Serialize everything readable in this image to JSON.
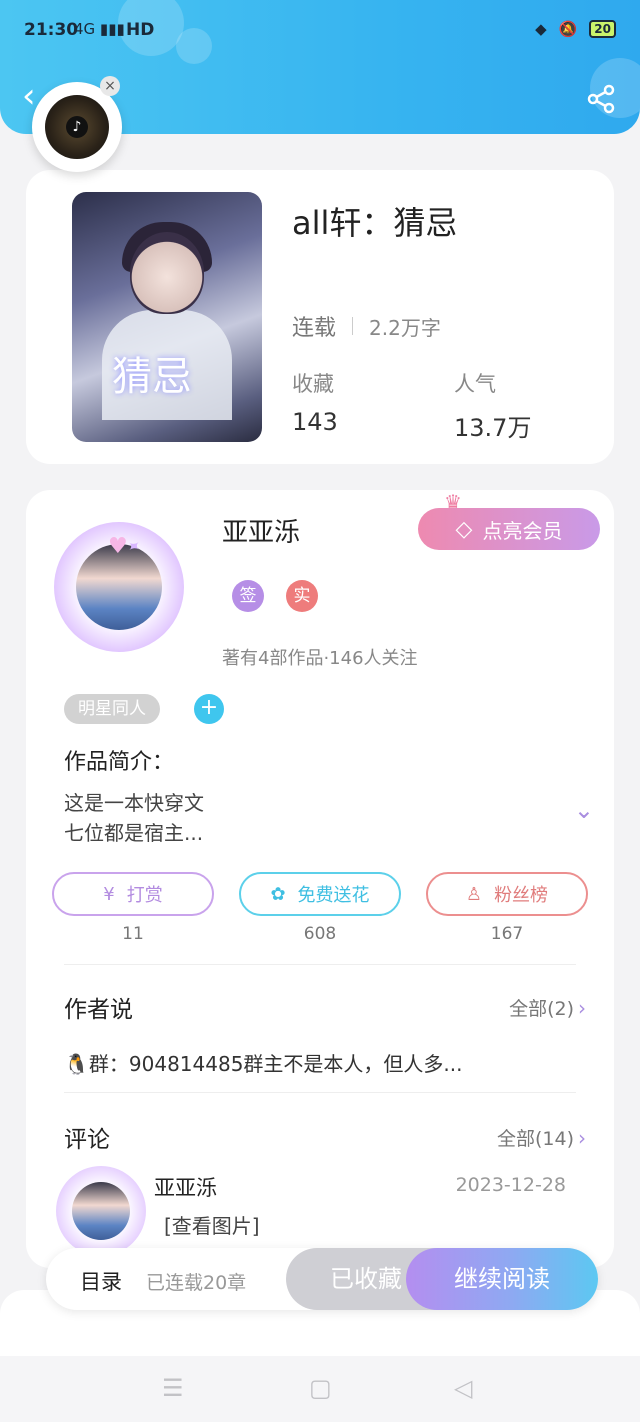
{
  "status_bar": {
    "time": "21:30",
    "signal": "4G ▮▮▮",
    "network": "HD",
    "battery": "20",
    "icons": [
      "gamepad-icon",
      "mute-icon",
      "battery-icon"
    ]
  },
  "header": {
    "back_icon": "‹",
    "music_close": "×"
  },
  "book": {
    "cover_title": "猜忌",
    "title": "all轩：猜忌",
    "status": "连载",
    "word_count": "2.2万字",
    "favorites_label": "收藏",
    "favorites_value": "143",
    "popularity_label": "人气",
    "popularity_value": "13.7万"
  },
  "author": {
    "name": "亚亚泺",
    "vip_label": "点亮会员",
    "badges": [
      "签",
      "实"
    ],
    "meta": "著有4部作品·146人关注",
    "tag": "明星同人",
    "intro_heading": "作品简介：",
    "intro_lines": [
      "这是一本快穿文",
      "七位都是宿主..."
    ]
  },
  "actions": [
    {
      "label": "打赏",
      "count": "11",
      "icon": "¥",
      "color": "#c9a3ec"
    },
    {
      "label": "免费送花",
      "count": "608",
      "icon": "✿",
      "color": "#5cd0ea"
    },
    {
      "label": "粉丝榜",
      "count": "167",
      "icon": "♙",
      "color": "#ec8f8f"
    }
  ],
  "author_says": {
    "heading": "作者说",
    "all": "全部(2)",
    "text": "🐧群：904814485群主不是本人，但人多..."
  },
  "comments": {
    "heading": "评论",
    "all": "全部(14)",
    "first": {
      "user": "亚亚泺",
      "date": "2023-12-28",
      "text": "[查看图片]"
    }
  },
  "bottom_bar": {
    "toc": "目录",
    "progress": "已连载20章",
    "collected": "已收藏",
    "read": "继续阅读"
  },
  "nav": {
    "menu": "☰",
    "home": "▢",
    "back": "◁"
  }
}
